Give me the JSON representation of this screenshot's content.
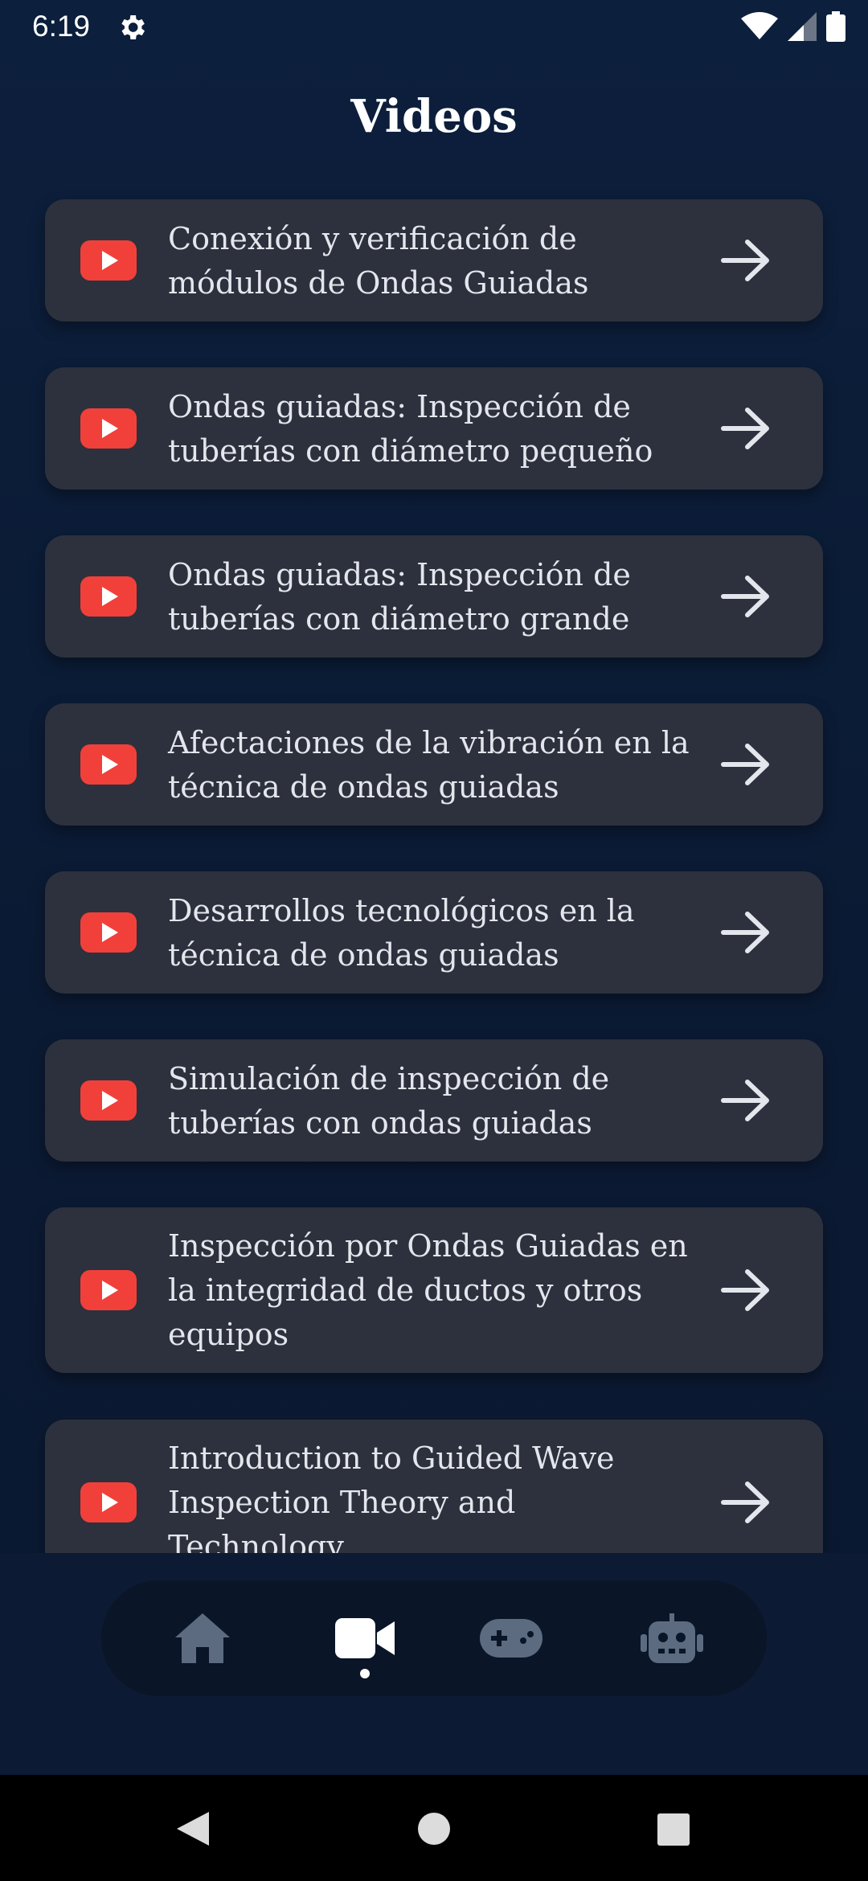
{
  "status_bar": {
    "time": "6:19",
    "icons": [
      "gear-icon",
      "wifi-icon",
      "signal-icon",
      "battery-icon"
    ]
  },
  "page": {
    "title": "Videos"
  },
  "videos": [
    {
      "title": "Conexión y verificación de módulos de Ondas Guiadas"
    },
    {
      "title": "Ondas guiadas: Inspección de tuberías con diámetro pequeño"
    },
    {
      "title": "Ondas guiadas: Inspección de tuberías con diámetro grande"
    },
    {
      "title": "Afectaciones de la vibración en la técnica de ondas guiadas"
    },
    {
      "title": "Desarrollos tecnológicos en la técnica de ondas guiadas"
    },
    {
      "title": "Simulación de inspección de tuberías con ondas guiadas"
    },
    {
      "title": "Inspección por Ondas Guiadas en la integridad de ductos y otros equipos"
    },
    {
      "title": "Introduction to Guided Wave Inspection Theory and Technology"
    }
  ],
  "bottom_nav": {
    "items": [
      {
        "icon": "home-icon",
        "active": false
      },
      {
        "icon": "video-camera-icon",
        "active": true
      },
      {
        "icon": "gamepad-icon",
        "active": false
      },
      {
        "icon": "robot-icon",
        "active": false
      }
    ]
  },
  "system_nav": [
    "back-icon",
    "home-circle-icon",
    "recents-icon"
  ],
  "colors": {
    "background": "#0c1f3c",
    "card": "#2c313d",
    "youtube_red": "#f1403a",
    "nav_inactive": "#5c6b7f",
    "nav_active": "#ffffff"
  }
}
